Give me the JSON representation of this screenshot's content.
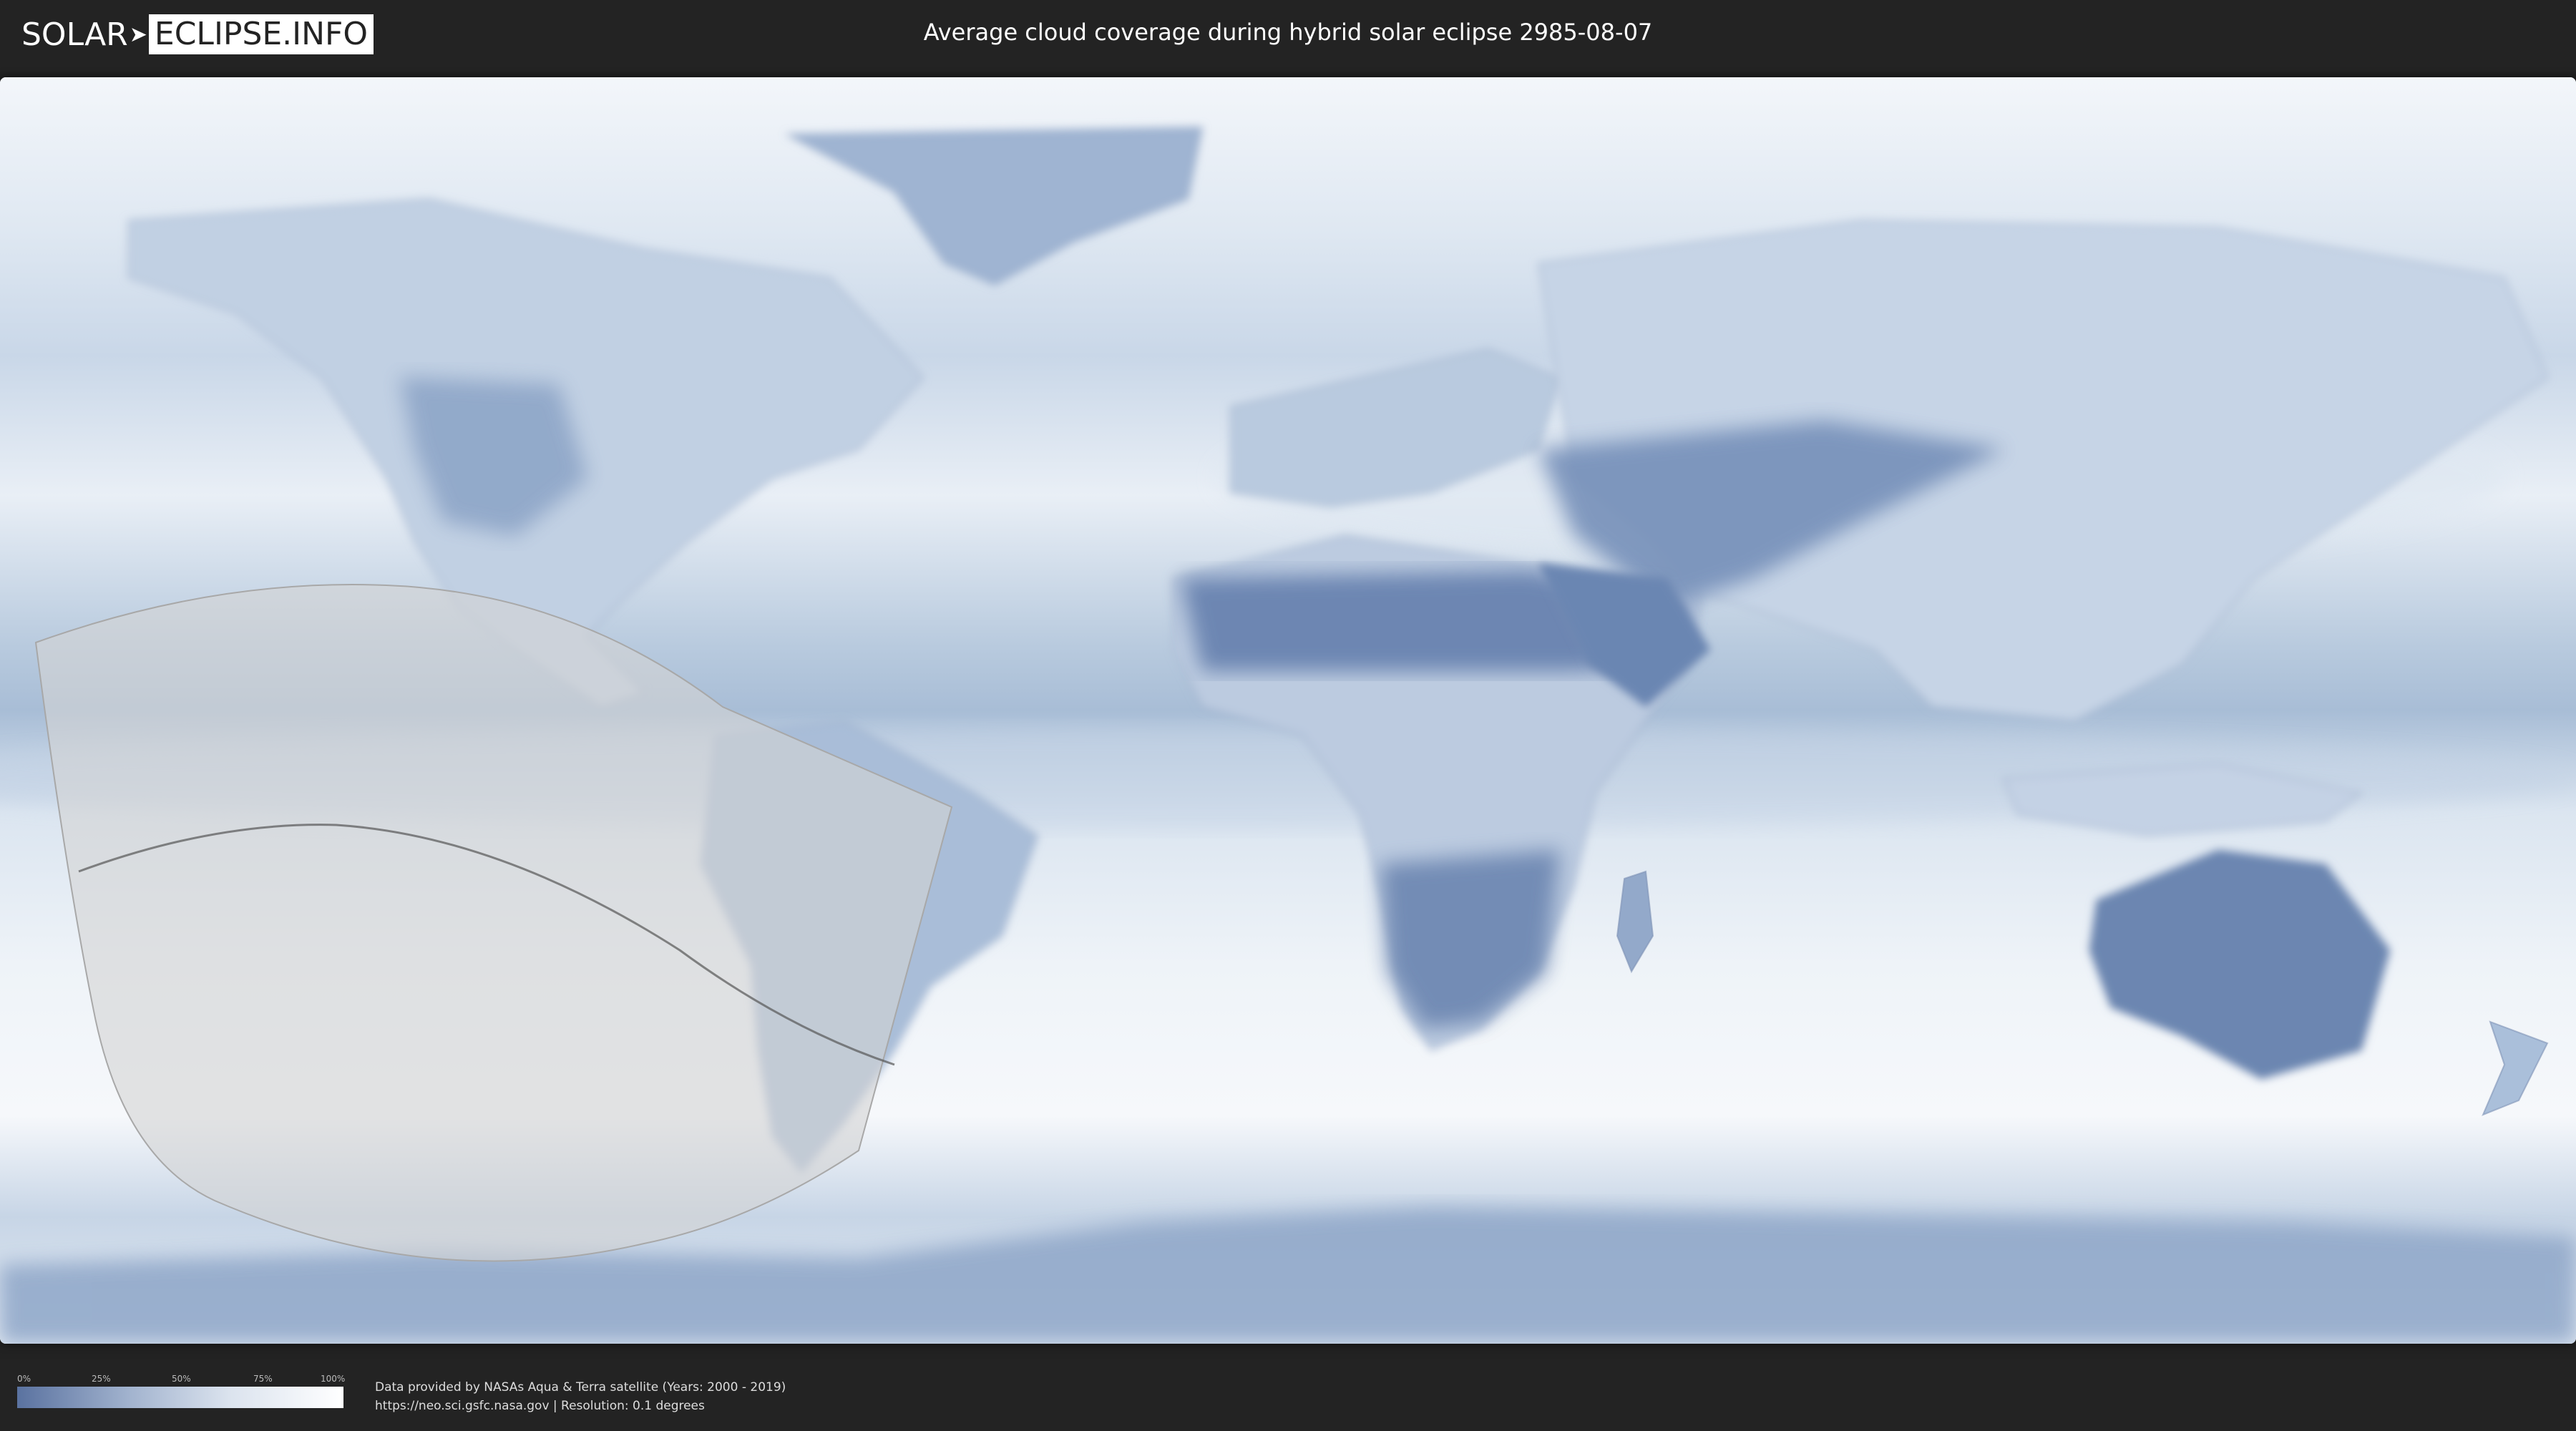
{
  "header": {
    "logo_left": "SOLAR",
    "logo_right": "ECLIPSE.INFO",
    "title": "Average cloud coverage during hybrid solar eclipse 2985-08-07"
  },
  "legend": {
    "ticks": [
      "0%",
      "25%",
      "50%",
      "75%",
      "100%"
    ],
    "colors": [
      "#5a72a0",
      "#ffffff"
    ]
  },
  "credits": {
    "line1": "Data provided by NASAs Aqua & Terra satellite (Years: 2000 - 2019)",
    "line2": "https://neo.sci.gsfc.nasa.gov | Resolution: 0.1 degrees"
  },
  "map": {
    "land_clear_color": "#5b79a8",
    "cloud_color": "#f4f7fb",
    "eclipse_overlay_color": "#d4d4d4"
  }
}
